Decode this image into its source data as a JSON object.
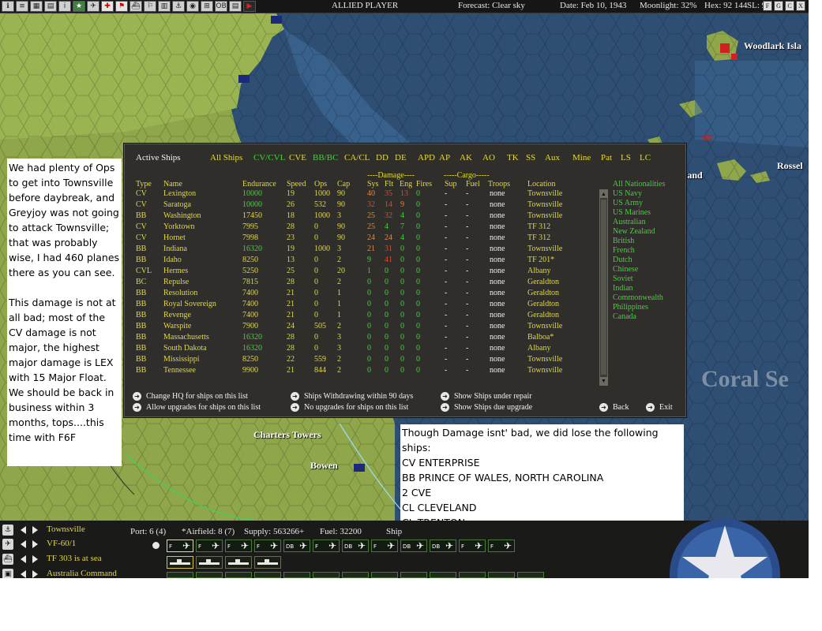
{
  "topbar": {
    "icons": [
      "ℹ",
      "≡",
      "▦",
      "▤",
      "i",
      "★",
      "✈",
      "✚",
      "⚑",
      "⛴",
      "⚐",
      "▥",
      "⚓",
      "◉",
      "⊞",
      "OB",
      "▤",
      "▶"
    ],
    "player": "ALLIED PLAYER",
    "forecast": "Forecast: Clear sky",
    "date": "Date: Feb 10, 1943",
    "moonlight": "Moonlight: 32%",
    "hex": "Hex: 92 144",
    "sl": "SL: 9",
    "right_buttons": [
      "F",
      "G",
      "C",
      "X"
    ]
  },
  "map": {
    "labels": {
      "woodlark": "Woodlark Isla",
      "rossel": "Rossel",
      "land": "land",
      "charters_towers": "Charters Towers",
      "bowen": "Bowen",
      "coral_sea": "Coral Se"
    }
  },
  "panel": {
    "title": "Active Ships",
    "filters": [
      {
        "label": "All Ships",
        "color": "yellow"
      },
      {
        "label": "CV/CVL",
        "color": "green"
      },
      {
        "label": "CVE",
        "color": "yellow"
      },
      {
        "label": "BB/BC",
        "color": "green"
      },
      {
        "label": "CA/CL",
        "color": "yellow"
      },
      {
        "label": "DD",
        "color": "yellow"
      },
      {
        "label": "DE",
        "color": "yellow"
      },
      {
        "label": "APD",
        "color": "yellow"
      },
      {
        "label": "AP",
        "color": "yellow"
      },
      {
        "label": "AK",
        "color": "yellow"
      },
      {
        "label": "AO",
        "color": "yellow"
      },
      {
        "label": "TK",
        "color": "yellow"
      },
      {
        "label": "SS",
        "color": "yellow"
      },
      {
        "label": "Aux",
        "color": "yellow"
      },
      {
        "label": "Mine",
        "color": "yellow"
      },
      {
        "label": "Pat",
        "color": "yellow"
      },
      {
        "label": "LS",
        "color": "yellow"
      },
      {
        "label": "LC",
        "color": "yellow"
      }
    ],
    "group_damage": "----Damage----",
    "group_cargo": "-----Cargo-----",
    "columns": {
      "type": "Type",
      "name": "Name",
      "endurance": "Endurance",
      "speed": "Speed",
      "ops": "Ops",
      "cap": "Cap",
      "sys": "Sys",
      "flt": "Flt",
      "eng": "Eng",
      "fires": "Fires",
      "sup": "Sup",
      "fuel": "Fuel",
      "troops": "Troops",
      "location": "Location"
    },
    "ships": [
      {
        "type": "CV",
        "name": "Lexington",
        "endurance": "10000",
        "speed": "19",
        "ops": "1000",
        "cap": "90",
        "sys": "40",
        "flt": "35",
        "eng": "13",
        "fires": "0",
        "sup": "-",
        "fuel": "-",
        "troops": "none",
        "location": "Townsville",
        "sys_c": "orange",
        "flt_c": "red",
        "eng_c": "red",
        "end_c": "green"
      },
      {
        "type": "CV",
        "name": "Saratoga",
        "endurance": "10000",
        "speed": "26",
        "ops": "532",
        "cap": "90",
        "sys": "32",
        "flt": "14",
        "eng": "9",
        "fires": "0",
        "sup": "-",
        "fuel": "-",
        "troops": "none",
        "location": "Townsville",
        "sys_c": "red",
        "flt_c": "red",
        "eng_c": "orange",
        "end_c": "green"
      },
      {
        "type": "BB",
        "name": "Washington",
        "endurance": "17450",
        "speed": "18",
        "ops": "1000",
        "cap": "3",
        "sys": "25",
        "flt": "32",
        "eng": "4",
        "fires": "0",
        "sup": "-",
        "fuel": "-",
        "troops": "none",
        "location": "Townsville",
        "sys_c": "orange",
        "flt_c": "red",
        "eng_c": "green",
        "end_c": "yellow"
      },
      {
        "type": "CV",
        "name": "Yorktown",
        "endurance": "7995",
        "speed": "28",
        "ops": "0",
        "cap": "90",
        "sys": "25",
        "flt": "4",
        "eng": "7",
        "fires": "0",
        "sup": "-",
        "fuel": "-",
        "troops": "none",
        "location": "TF 312",
        "sys_c": "orange",
        "flt_c": "green",
        "eng_c": "green",
        "end_c": "yellow"
      },
      {
        "type": "CV",
        "name": "Hornet",
        "endurance": "7998",
        "speed": "23",
        "ops": "0",
        "cap": "90",
        "sys": "24",
        "flt": "24",
        "eng": "4",
        "fires": "0",
        "sup": "-",
        "fuel": "-",
        "troops": "none",
        "location": "TF 312",
        "sys_c": "orange",
        "flt_c": "orange",
        "eng_c": "green",
        "end_c": "yellow"
      },
      {
        "type": "BB",
        "name": "Indiana",
        "endurance": "16320",
        "speed": "19",
        "ops": "1000",
        "cap": "3",
        "sys": "21",
        "flt": "31",
        "eng": "0",
        "fires": "0",
        "sup": "-",
        "fuel": "-",
        "troops": "none",
        "location": "Townsville",
        "sys_c": "orange",
        "flt_c": "red",
        "eng_c": "green",
        "end_c": "green"
      },
      {
        "type": "BB",
        "name": "Idaho",
        "endurance": "8250",
        "speed": "13",
        "ops": "0",
        "cap": "2",
        "sys": "9",
        "flt": "41",
        "eng": "0",
        "fires": "0",
        "sup": "-",
        "fuel": "-",
        "troops": "none",
        "location": "TF 201*",
        "sys_c": "green",
        "flt_c": "red",
        "eng_c": "green",
        "end_c": "yellow"
      },
      {
        "type": "CVL",
        "name": "Hermes",
        "endurance": "5250",
        "speed": "25",
        "ops": "0",
        "cap": "20",
        "sys": "1",
        "flt": "0",
        "eng": "0",
        "fires": "0",
        "sup": "-",
        "fuel": "-",
        "troops": "none",
        "location": "Albany",
        "sys_c": "green",
        "flt_c": "green",
        "eng_c": "green",
        "end_c": "yellow"
      },
      {
        "type": "BC",
        "name": "Repulse",
        "endurance": "7815",
        "speed": "28",
        "ops": "0",
        "cap": "2",
        "sys": "0",
        "flt": "0",
        "eng": "0",
        "fires": "0",
        "sup": "-",
        "fuel": "-",
        "troops": "none",
        "location": "Geraldton",
        "sys_c": "green",
        "flt_c": "green",
        "eng_c": "green",
        "end_c": "yellow"
      },
      {
        "type": "BB",
        "name": "Resolution",
        "endurance": "7400",
        "speed": "21",
        "ops": "0",
        "cap": "1",
        "sys": "0",
        "flt": "0",
        "eng": "0",
        "fires": "0",
        "sup": "-",
        "fuel": "-",
        "troops": "none",
        "location": "Geraldton",
        "sys_c": "green",
        "flt_c": "green",
        "eng_c": "green",
        "end_c": "yellow"
      },
      {
        "type": "BB",
        "name": "Royal Sovereign",
        "endurance": "7400",
        "speed": "21",
        "ops": "0",
        "cap": "1",
        "sys": "0",
        "flt": "0",
        "eng": "0",
        "fires": "0",
        "sup": "-",
        "fuel": "-",
        "troops": "none",
        "location": "Geraldton",
        "sys_c": "green",
        "flt_c": "green",
        "eng_c": "green",
        "end_c": "yellow"
      },
      {
        "type": "BB",
        "name": "Revenge",
        "endurance": "7400",
        "speed": "21",
        "ops": "0",
        "cap": "1",
        "sys": "0",
        "flt": "0",
        "eng": "0",
        "fires": "0",
        "sup": "-",
        "fuel": "-",
        "troops": "none",
        "location": "Geraldton",
        "sys_c": "green",
        "flt_c": "green",
        "eng_c": "green",
        "end_c": "yellow"
      },
      {
        "type": "BB",
        "name": "Warspite",
        "endurance": "7900",
        "speed": "24",
        "ops": "505",
        "cap": "2",
        "sys": "0",
        "flt": "0",
        "eng": "0",
        "fires": "0",
        "sup": "-",
        "fuel": "-",
        "troops": "none",
        "location": "Townsville",
        "sys_c": "green",
        "flt_c": "green",
        "eng_c": "green",
        "end_c": "yellow"
      },
      {
        "type": "BB",
        "name": "Massachusetts",
        "endurance": "16320",
        "speed": "28",
        "ops": "0",
        "cap": "3",
        "sys": "0",
        "flt": "0",
        "eng": "0",
        "fires": "0",
        "sup": "-",
        "fuel": "-",
        "troops": "none",
        "location": "Balboa*",
        "sys_c": "green",
        "flt_c": "green",
        "eng_c": "green",
        "end_c": "green"
      },
      {
        "type": "BB",
        "name": "South Dakota",
        "endurance": "16320",
        "speed": "28",
        "ops": "0",
        "cap": "3",
        "sys": "0",
        "flt": "0",
        "eng": "0",
        "fires": "0",
        "sup": "-",
        "fuel": "-",
        "troops": "none",
        "location": "Albany",
        "sys_c": "green",
        "flt_c": "green",
        "eng_c": "green",
        "end_c": "green"
      },
      {
        "type": "BB",
        "name": "Mississippi",
        "endurance": "8250",
        "speed": "22",
        "ops": "559",
        "cap": "2",
        "sys": "0",
        "flt": "0",
        "eng": "0",
        "fires": "0",
        "sup": "-",
        "fuel": "-",
        "troops": "none",
        "location": "Townsville",
        "sys_c": "green",
        "flt_c": "green",
        "eng_c": "green",
        "end_c": "yellow"
      },
      {
        "type": "BB",
        "name": "Tennessee",
        "endurance": "9900",
        "speed": "21",
        "ops": "844",
        "cap": "2",
        "sys": "0",
        "flt": "0",
        "eng": "0",
        "fires": "0",
        "sup": "-",
        "fuel": "-",
        "troops": "none",
        "location": "Townsville",
        "sys_c": "green",
        "flt_c": "green",
        "eng_c": "green",
        "end_c": "yellow"
      }
    ],
    "nationalities": [
      "All Nationalities",
      "US Navy",
      "US Army",
      "US Marines",
      "Australian",
      "New Zealand",
      "British",
      "French",
      "Dutch",
      "Chinese",
      "Soviet",
      "Indian",
      "Commonwealth",
      "Philippines",
      "Canada"
    ],
    "options": {
      "change_hq": "Change HQ for ships on this list",
      "allow_upgrades": "Allow upgrades for ships on this list",
      "withdrawing": "Ships Withdrawing within 90 days",
      "no_upgrades": "No upgrades for ships on this list",
      "under_repair": "Show Ships under repair",
      "due_upgrade": "Show Ships due upgrade",
      "back": "Back",
      "exit": "Exit"
    }
  },
  "note_left": {
    "p1": "We had plenty of Ops to get into Townsville before daybreak, and Greyjoy was not going to attack Townsville; that was probably wise, I had 460 planes there as you can see.",
    "p2": "This damage is not at all bad; most of the CV damage is not major, the highest major damage is LEX with 15 Major Float. We should be back in business within 3 months, tops....this time with F6F"
  },
  "note_right": {
    "lines": [
      "Though Damage isnt' bad, we did lose the following ships:",
      "CV ENTERPRISE",
      "BB PRINCE OF WALES, NORTH CAROLINA",
      "2 CVE",
      "CL CLEVELAND",
      "CL TRENTON"
    ]
  },
  "bottom": {
    "base": "Townsville",
    "port": "Port: 6 (4)",
    "airfield": "*Airfield: 8 (7)",
    "supply": "Supply: 563266+",
    "fuel": "Fuel: 32200",
    "ship_trunc": "Ship",
    "air_unit": "VF-60/1",
    "tf": "TF 303 is at sea",
    "command": "Australia Command",
    "air_slots": [
      "F",
      "F",
      "F",
      "F",
      "DB",
      "F",
      "DB",
      "F",
      "DB",
      "DB",
      "F",
      "F"
    ]
  },
  "colors": {
    "panel_bg": "#2f2e2a",
    "header_yellow": "#e3d93b",
    "green": "#42d33a",
    "red": "#e04a2a",
    "orange": "#e8863a",
    "ocean": "#2f4e74",
    "land": "#8aa046"
  }
}
